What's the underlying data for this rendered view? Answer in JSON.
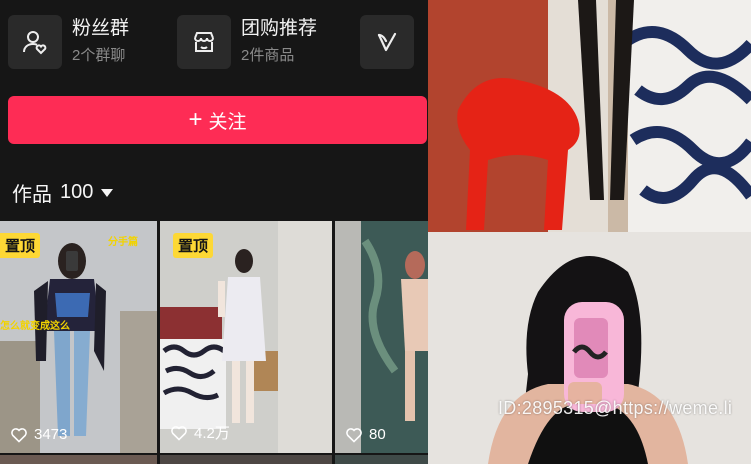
{
  "profile": {
    "fans_group": {
      "title": "粉丝群",
      "subtitle": "2个群聊",
      "icon": "people-heart-icon"
    },
    "group_buy": {
      "title": "团购推荐",
      "subtitle": "2件商品",
      "icon": "shop-icon"
    },
    "v_entry": {
      "icon": "v-icon"
    },
    "follow_button": {
      "label": "关注",
      "icon": "plus-icon"
    }
  },
  "works": {
    "label": "作品",
    "count": "100",
    "items": [
      {
        "pinned_label": "置顶",
        "likes": "3473",
        "overlay_texts": [
          "分手篇",
          "怎么就变成这么"
        ]
      },
      {
        "pinned_label": "置顶",
        "likes": "4.2万"
      },
      {
        "likes": "80"
      }
    ]
  },
  "watermark": "ID:2895315@https://weme.li",
  "colors": {
    "accent": "#fe2c55",
    "pin": "#fdd835",
    "background": "#161616"
  }
}
